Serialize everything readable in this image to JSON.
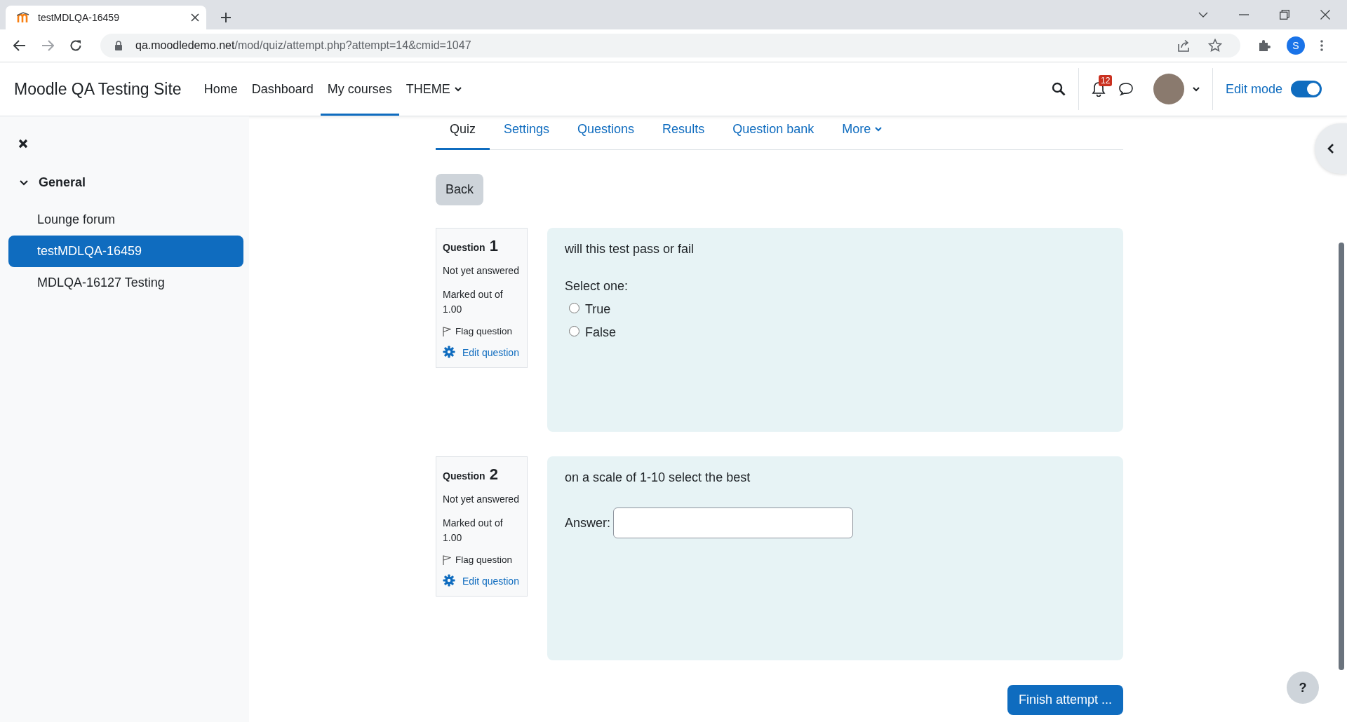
{
  "browser": {
    "tab_title": "testMDLQA-16459",
    "address_host": "qa.moodledemo.net",
    "address_path": "/mod/quiz/attempt.php?attempt=14&cmid=1047",
    "profile_initial": "S"
  },
  "site": {
    "name": "Moodle QA Testing Site",
    "nav": [
      {
        "label": "Home",
        "selected": false,
        "kind": "link"
      },
      {
        "label": "Dashboard",
        "selected": false,
        "kind": "link"
      },
      {
        "label": "My courses",
        "selected": true,
        "kind": "link"
      },
      {
        "label": "THEME",
        "selected": false,
        "kind": "dropdown"
      }
    ],
    "notification_count": "12",
    "edit_mode": {
      "label": "Edit mode",
      "on": true
    }
  },
  "sidebar": {
    "section": {
      "label": "General",
      "expanded": true,
      "children": [
        {
          "label": "Lounge forum",
          "selected": false
        },
        {
          "label": "testMDLQA-16459",
          "selected": true
        },
        {
          "label": "MDLQA-16127 Testing",
          "selected": false
        }
      ]
    }
  },
  "tabs": [
    {
      "label": "Quiz",
      "selected": true,
      "kind": "link"
    },
    {
      "label": "Settings",
      "selected": false,
      "kind": "link"
    },
    {
      "label": "Questions",
      "selected": false,
      "kind": "link"
    },
    {
      "label": "Results",
      "selected": false,
      "kind": "link"
    },
    {
      "label": "Question bank",
      "selected": false,
      "kind": "link"
    },
    {
      "label": "More",
      "selected": false,
      "kind": "dropdown"
    }
  ],
  "back_button": "Back",
  "questions": [
    {
      "heading": "Question",
      "number": "1",
      "status": "Not yet answered",
      "marks": "Marked out of 1.00",
      "flag_label": "Flag question",
      "edit_label": "Edit question",
      "text": "will this test pass or fail",
      "kind": "multichoice",
      "prompt": "Select one:",
      "options": [
        {
          "label": "True",
          "selected": false
        },
        {
          "label": "False",
          "selected": false
        }
      ]
    },
    {
      "heading": "Question",
      "number": "2",
      "status": "Not yet answered",
      "marks": "Marked out of 1.00",
      "flag_label": "Flag question",
      "edit_label": "Edit question",
      "text": "on a scale of 1-10 select the best",
      "kind": "shortanswer",
      "answer_label": "Answer:"
    }
  ],
  "finish_button": "Finish attempt ...",
  "help_button": "?"
}
